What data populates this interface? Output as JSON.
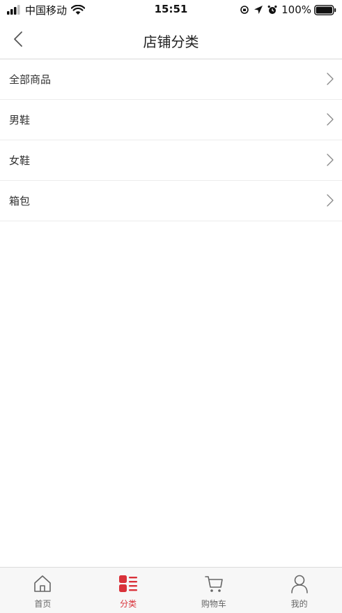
{
  "status_bar": {
    "carrier": "中国移动",
    "time": "15:51",
    "battery": "100%"
  },
  "header": {
    "title": "店铺分类"
  },
  "categories": [
    {
      "label": "全部商品"
    },
    {
      "label": "男鞋"
    },
    {
      "label": "女鞋"
    },
    {
      "label": "箱包"
    }
  ],
  "tabs": [
    {
      "label": "首页",
      "icon": "home-icon",
      "active": false
    },
    {
      "label": "分类",
      "icon": "category-icon",
      "active": true
    },
    {
      "label": "购物车",
      "icon": "cart-icon",
      "active": false
    },
    {
      "label": "我的",
      "icon": "user-icon",
      "active": false
    }
  ],
  "colors": {
    "accent": "#d9323a",
    "tab_inactive": "#666666",
    "divider": "#ececec"
  }
}
